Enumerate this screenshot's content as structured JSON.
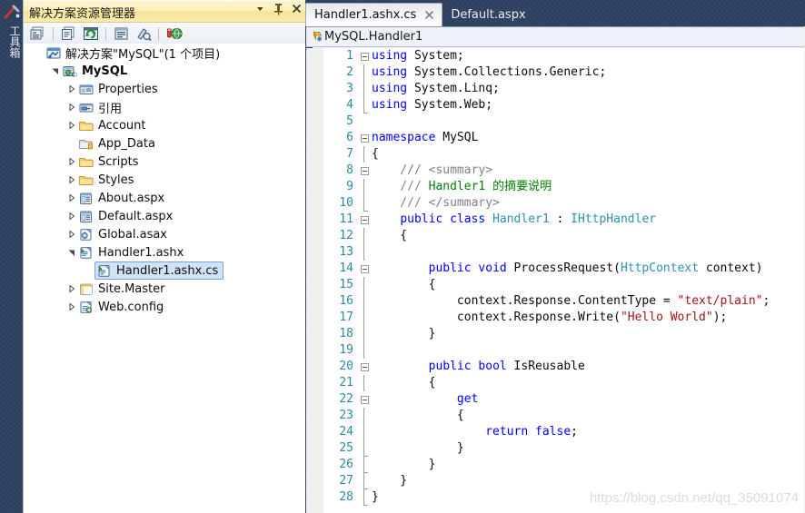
{
  "toolbox": {
    "label": "工具箱",
    "icon": "toolbox-icon"
  },
  "solution_explorer": {
    "title": "解决方案资源管理器",
    "title_buttons": [
      {
        "name": "dropdown-icon",
        "glyph": "▾"
      },
      {
        "name": "pin-icon",
        "glyph": "pin"
      },
      {
        "name": "close-icon",
        "glyph": "✕"
      }
    ],
    "toolbar": [
      {
        "name": "properties-window-icon",
        "tooltip": "属性窗口"
      },
      {
        "name": "show-all-files-icon",
        "tooltip": "显示所有文件"
      },
      {
        "name": "refresh-icon",
        "tooltip": "刷新"
      },
      {
        "name": "view-code-icon",
        "tooltip": "查看代码"
      },
      {
        "name": "view-designer-icon",
        "tooltip": "查看设计器"
      },
      {
        "name": "publish-icon",
        "tooltip": "发布"
      }
    ],
    "tree": [
      {
        "label": "解决方案\"MySQL\"(1 个项目)",
        "indent": 0,
        "expander": "none",
        "icon": "solution-icon",
        "bold": false,
        "selected": false
      },
      {
        "label": "MySQL",
        "indent": 1,
        "expander": "expanded",
        "icon": "project-csharp-icon",
        "bold": true,
        "selected": false
      },
      {
        "label": "Properties",
        "indent": 2,
        "expander": "collapsed",
        "icon": "properties-icon",
        "bold": false,
        "selected": false
      },
      {
        "label": "引用",
        "indent": 2,
        "expander": "collapsed",
        "icon": "references-icon",
        "bold": false,
        "selected": false
      },
      {
        "label": "Account",
        "indent": 2,
        "expander": "collapsed",
        "icon": "folder-icon",
        "bold": false,
        "selected": false
      },
      {
        "label": "App_Data",
        "indent": 2,
        "expander": "none",
        "icon": "folder-special-icon",
        "bold": false,
        "selected": false
      },
      {
        "label": "Scripts",
        "indent": 2,
        "expander": "collapsed",
        "icon": "folder-icon",
        "bold": false,
        "selected": false
      },
      {
        "label": "Styles",
        "indent": 2,
        "expander": "collapsed",
        "icon": "folder-icon",
        "bold": false,
        "selected": false
      },
      {
        "label": "About.aspx",
        "indent": 2,
        "expander": "collapsed",
        "icon": "aspx-icon",
        "bold": false,
        "selected": false
      },
      {
        "label": "Default.aspx",
        "indent": 2,
        "expander": "collapsed",
        "icon": "aspx-icon",
        "bold": false,
        "selected": false
      },
      {
        "label": "Global.asax",
        "indent": 2,
        "expander": "collapsed",
        "icon": "asax-icon",
        "bold": false,
        "selected": false
      },
      {
        "label": "Handler1.ashx",
        "indent": 2,
        "expander": "expanded",
        "icon": "ashx-icon",
        "bold": false,
        "selected": false
      },
      {
        "label": "Handler1.ashx.cs",
        "indent": 3,
        "expander": "none",
        "icon": "cs-file-icon",
        "bold": false,
        "selected": true
      },
      {
        "label": "Site.Master",
        "indent": 2,
        "expander": "collapsed",
        "icon": "master-icon",
        "bold": false,
        "selected": false
      },
      {
        "label": "Web.config",
        "indent": 2,
        "expander": "collapsed",
        "icon": "config-icon",
        "bold": false,
        "selected": false
      }
    ]
  },
  "editor": {
    "tabs": [
      {
        "label": "Handler1.ashx.cs",
        "active": true,
        "closable": true
      },
      {
        "label": "Default.aspx",
        "active": false,
        "closable": false
      }
    ],
    "breadcrumb": {
      "icon": "class-icon",
      "text": "MySQL.Handler1"
    },
    "watermark": "https://blog.csdn.net/qq_35091074",
    "lines": [
      {
        "n": 1,
        "fold": "minus",
        "tokens": [
          {
            "t": "using",
            "c": "kw"
          },
          {
            "t": " System;",
            "c": "pl"
          }
        ]
      },
      {
        "n": 2,
        "fold": "bar",
        "tokens": [
          {
            "t": "using",
            "c": "kw"
          },
          {
            "t": " System.Collections.Generic;",
            "c": "pl"
          }
        ]
      },
      {
        "n": 3,
        "fold": "bar",
        "tokens": [
          {
            "t": "using",
            "c": "kw"
          },
          {
            "t": " System.Linq;",
            "c": "pl"
          }
        ]
      },
      {
        "n": 4,
        "fold": "barend",
        "tokens": [
          {
            "t": "using",
            "c": "kw"
          },
          {
            "t": " System.Web;",
            "c": "pl"
          }
        ]
      },
      {
        "n": 5,
        "fold": "none",
        "tokens": []
      },
      {
        "n": 6,
        "fold": "minus",
        "tokens": [
          {
            "t": "namespace",
            "c": "kw"
          },
          {
            "t": " MySQL",
            "c": "pl"
          }
        ]
      },
      {
        "n": 7,
        "fold": "bar",
        "tokens": [
          {
            "t": "{",
            "c": "pl"
          }
        ]
      },
      {
        "n": 8,
        "fold": "minus",
        "tokens": [
          {
            "t": "    /// ",
            "c": "cm"
          },
          {
            "t": "<summary>",
            "c": "cm"
          }
        ]
      },
      {
        "n": 9,
        "fold": "bar",
        "tokens": [
          {
            "t": "    /// ",
            "c": "cm"
          },
          {
            "t": "Handler1 的摘要说明",
            "c": "cmg"
          }
        ]
      },
      {
        "n": 10,
        "fold": "barend",
        "tokens": [
          {
            "t": "    /// ",
            "c": "cm"
          },
          {
            "t": "</summary>",
            "c": "cm"
          }
        ]
      },
      {
        "n": 11,
        "fold": "minus",
        "tokens": [
          {
            "t": "    ",
            "c": "pl"
          },
          {
            "t": "public class",
            "c": "kw"
          },
          {
            "t": " ",
            "c": "pl"
          },
          {
            "t": "Handler1",
            "c": "ty"
          },
          {
            "t": " : ",
            "c": "pl"
          },
          {
            "t": "IHttpHandler",
            "c": "ty"
          }
        ]
      },
      {
        "n": 12,
        "fold": "bar",
        "tokens": [
          {
            "t": "    {",
            "c": "pl"
          }
        ]
      },
      {
        "n": 13,
        "fold": "bar",
        "tokens": []
      },
      {
        "n": 14,
        "fold": "minus",
        "tokens": [
          {
            "t": "        ",
            "c": "pl"
          },
          {
            "t": "public void",
            "c": "kw"
          },
          {
            "t": " ProcessRequest(",
            "c": "pl"
          },
          {
            "t": "HttpContext",
            "c": "ty"
          },
          {
            "t": " context)",
            "c": "pl"
          }
        ]
      },
      {
        "n": 15,
        "fold": "bar",
        "tokens": [
          {
            "t": "        {",
            "c": "pl"
          }
        ]
      },
      {
        "n": 16,
        "fold": "bar",
        "tokens": [
          {
            "t": "            context.Response.ContentType = ",
            "c": "pl"
          },
          {
            "t": "\"text/plain\"",
            "c": "st"
          },
          {
            "t": ";",
            "c": "pl"
          }
        ]
      },
      {
        "n": 17,
        "fold": "bar",
        "tokens": [
          {
            "t": "            context.Response.Write(",
            "c": "pl"
          },
          {
            "t": "\"Hello World\"",
            "c": "st"
          },
          {
            "t": ");",
            "c": "pl"
          }
        ]
      },
      {
        "n": 18,
        "fold": "bar",
        "tokens": [
          {
            "t": "        }",
            "c": "pl"
          }
        ]
      },
      {
        "n": 19,
        "fold": "bar",
        "tokens": []
      },
      {
        "n": 20,
        "fold": "minus",
        "tokens": [
          {
            "t": "        ",
            "c": "pl"
          },
          {
            "t": "public bool",
            "c": "kw"
          },
          {
            "t": " IsReusable",
            "c": "pl"
          }
        ]
      },
      {
        "n": 21,
        "fold": "bar",
        "tokens": [
          {
            "t": "        {",
            "c": "pl"
          }
        ]
      },
      {
        "n": 22,
        "fold": "minus",
        "tokens": [
          {
            "t": "            ",
            "c": "pl"
          },
          {
            "t": "get",
            "c": "kw"
          }
        ]
      },
      {
        "n": 23,
        "fold": "bar",
        "tokens": [
          {
            "t": "            {",
            "c": "pl"
          }
        ]
      },
      {
        "n": 24,
        "fold": "bar",
        "tokens": [
          {
            "t": "                ",
            "c": "pl"
          },
          {
            "t": "return false",
            "c": "kw"
          },
          {
            "t": ";",
            "c": "pl"
          }
        ]
      },
      {
        "n": 25,
        "fold": "barend",
        "tokens": [
          {
            "t": "            }",
            "c": "pl"
          }
        ]
      },
      {
        "n": 26,
        "fold": "barend",
        "tokens": [
          {
            "t": "        }",
            "c": "pl"
          }
        ]
      },
      {
        "n": 27,
        "fold": "barend",
        "tokens": [
          {
            "t": "    }",
            "c": "pl"
          }
        ]
      },
      {
        "n": 28,
        "fold": "barend",
        "tokens": [
          {
            "t": "}",
            "c": "pl"
          }
        ]
      }
    ]
  },
  "colors": {
    "chrome_dark": "#2d3f5f",
    "title_gold": "#f7e49a",
    "selection_blue": "#cfe3f7",
    "linenumber_teal": "#2b8a9e",
    "keyword_blue": "#0000ff",
    "type_teal": "#2b91af",
    "string_red": "#a31515",
    "comment_gray": "#808080",
    "comment_green": "#008000"
  }
}
